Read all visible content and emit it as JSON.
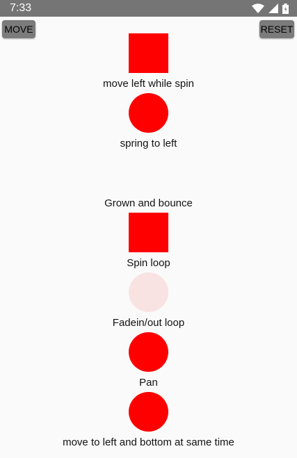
{
  "status_bar": {
    "time": "7:33",
    "icons": [
      "wifi-icon",
      "cell-signal-icon",
      "battery-icon"
    ]
  },
  "toolbar": {
    "move_label": "MOVE",
    "reset_label": "RESET"
  },
  "animations": [
    {
      "label": "move left while spin",
      "shape": "square"
    },
    {
      "label": "spring to left",
      "shape": "circle"
    },
    {
      "label": "Grown and bounce",
      "shape": "none"
    },
    {
      "label": "Spin loop",
      "shape": "square"
    },
    {
      "label": "Fadein/out loop",
      "shape": "circle-faded"
    },
    {
      "label": "Pan",
      "shape": "circle"
    },
    {
      "label": "move to left and bottom at same time",
      "shape": "circle"
    }
  ],
  "colors": {
    "shape": "#ff0000",
    "shape_faded": "#f9e2e2",
    "status_bar": "#757575",
    "button": "#7b7b7b",
    "background": "#fafafa"
  }
}
